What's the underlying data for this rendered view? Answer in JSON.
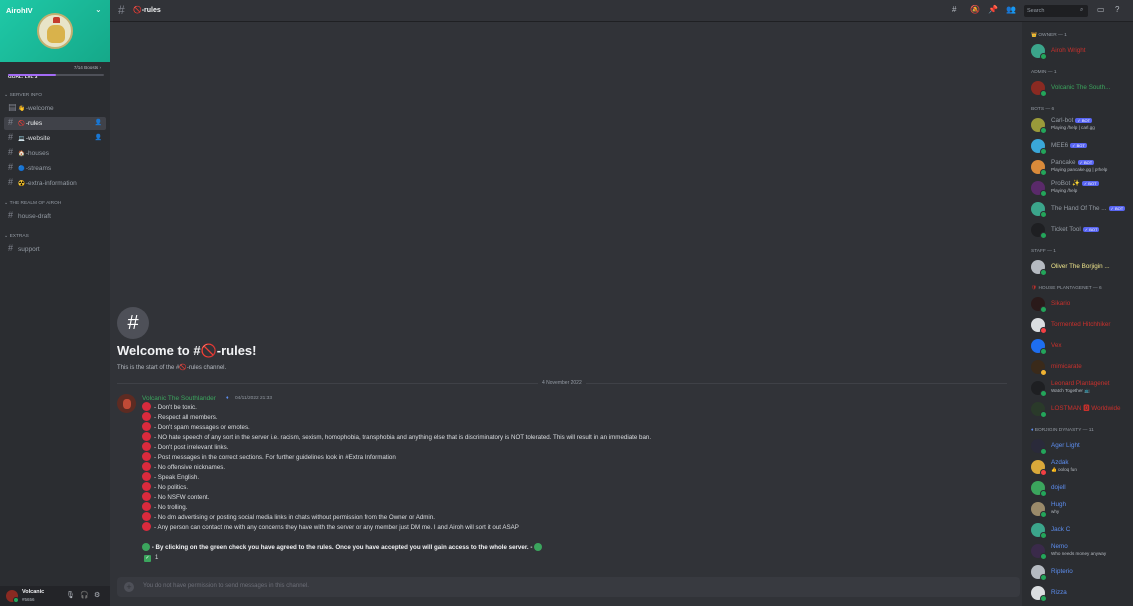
{
  "server": {
    "name": "AirohIV",
    "goal_label": "GOAL: LVL 3",
    "boosts": "7/14 Boosts",
    "boost_progress": 0.5
  },
  "sidebar": {
    "categories": [
      {
        "name": "SERVER INFO",
        "channels": [
          {
            "emoji": "👋",
            "name": "-welcome",
            "icon": "rules-icon"
          },
          {
            "emoji": "🚫",
            "name": "-rules",
            "icon": "hash-icon",
            "active": true
          },
          {
            "emoji": "💻",
            "name": "-website",
            "icon": "hash-icon"
          },
          {
            "emoji": "🏠",
            "name": "-houses",
            "icon": "hash-icon"
          },
          {
            "emoji": "🔵",
            "name": "-streams",
            "icon": "hash-icon"
          },
          {
            "emoji": "☢️",
            "name": "-extra-information",
            "icon": "hash-icon"
          }
        ]
      },
      {
        "name": "THE REALM OF AIROH",
        "channels": [
          {
            "name": "house-draft",
            "icon": "hash-icon"
          }
        ]
      },
      {
        "name": "EXTRAS",
        "channels": [
          {
            "name": "support",
            "icon": "hash-icon"
          }
        ]
      }
    ]
  },
  "user_panel": {
    "name": "Volcanic",
    "tag": "#5656"
  },
  "header": {
    "channel": "-rules",
    "search_placeholder": "Search"
  },
  "welcome": {
    "title": "Welcome to #🚫-rules!",
    "subtitle": "This is the start of the #🚫-rules channel."
  },
  "divider_date": "4 November 2022",
  "message": {
    "author": "Volcanic The Southlander",
    "timestamp": "04/11/2022 21:33",
    "rules": [
      "Don't be toxic.",
      "Respect all members.",
      "Don't spam messages or emotes.",
      "NO hate speech of any sort in the server i.e. racism, sexism, homophobia, transphobia and anything else that is discriminatory is NOT tolerated. This will result in an immediate ban.",
      "Don't post irrelevant links.",
      "Post messages in the correct sections. For further guidelines look in #Extra Information",
      "No offensive nicknames.",
      "Speak English.",
      "No politics.",
      "No NSFW content.",
      "No trolling.",
      "No dm advertising or posting social media links in chats without permission from the Owner or Admin.",
      "Any person can contact me with any concerns they have with the server or any member just DM me. I and Airoh will sort it out ASAP"
    ],
    "accept_text": "By clicking on the green check you have agreed to the rules. Once you have accepted you will gain access to the whole server.",
    "reaction_count": "1"
  },
  "input": {
    "placeholder": "You do not have permission to send messages in this channel."
  },
  "members": {
    "groups": [
      {
        "label": "OWNER — 1",
        "color": "#c9302c",
        "members": [
          {
            "name": "Airoh Wright",
            "avatar_color": "#3ba58b",
            "status": "online"
          }
        ]
      },
      {
        "label": "ADMIN — 1",
        "color": "#3ba55d",
        "members": [
          {
            "name": "Volcanic The South...",
            "avatar_color": "#8a2a22",
            "status": "online"
          }
        ]
      },
      {
        "label": "BOTS — 6",
        "color": "#949ba4",
        "members": [
          {
            "name": "Carl-bot",
            "activity": "Playing /help | carl.gg",
            "bot": true,
            "avatar_color": "#9a9a3a",
            "status": "online"
          },
          {
            "name": "MEE6",
            "bot": true,
            "avatar_color": "#3aa7d9",
            "status": "online"
          },
          {
            "name": "Pancake",
            "activity": "Playing pancake.gg | p!help",
            "bot": true,
            "avatar_color": "#d98a3a",
            "status": "online"
          },
          {
            "name": "ProBot ✨",
            "activity": "Playing /help",
            "bot": true,
            "avatar_color": "#5a2a6a",
            "status": "online"
          },
          {
            "name": "The Hand Of The ...",
            "bot": true,
            "avatar_color": "#3ba58b",
            "status": "online"
          },
          {
            "name": "Ticket Tool",
            "bot": true,
            "avatar_color": "#1e1f22",
            "status": "online"
          }
        ]
      },
      {
        "label": "STAFF — 1",
        "color": "#f0e68c",
        "members": [
          {
            "name": "Oliver The Borjigin ...",
            "avatar_color": "#b5bac1",
            "status": "online"
          }
        ]
      },
      {
        "label": "HOUSE PLANTAGENET — 6",
        "color": "#c9302c",
        "members": [
          {
            "name": "Sikario",
            "avatar_color": "#2a1a1a",
            "status": "online"
          },
          {
            "name": "Tormented Hitchhiker",
            "avatar_color": "#dbdee1",
            "status": "dnd"
          },
          {
            "name": "Vex",
            "avatar_color": "#1e6ef0",
            "status": "online"
          },
          {
            "name": "mimicarate",
            "avatar_color": "#3a2a1a",
            "status": "idle"
          },
          {
            "name": "Leonard Plantagenet",
            "activity": "Watch Together 📺",
            "avatar_color": "#1e1f22",
            "status": "online"
          },
          {
            "name": "LOSTMAN 🅾 Worldwide",
            "avatar_color": "#2a3a2a",
            "status": "online"
          }
        ]
      },
      {
        "label": "BORJIGIN DYNASTY — 11",
        "color": "#5d8ef0",
        "members": [
          {
            "name": "Ager Light",
            "avatar_color": "#2a2a3a",
            "status": "online"
          },
          {
            "name": "Azdak",
            "activity": "👍 ooloq fun",
            "avatar_color": "#d9a83a",
            "status": "dnd"
          },
          {
            "name": "dojell",
            "avatar_color": "#3ba55d",
            "status": "online"
          },
          {
            "name": "Hugh",
            "activity": "why",
            "avatar_color": "#9a8a6a",
            "status": "online"
          },
          {
            "name": "Jack C",
            "avatar_color": "#3ba58b",
            "status": "online"
          },
          {
            "name": "Nemo",
            "activity": "Who needs money anyway",
            "avatar_color": "#3a2a4a",
            "status": "online"
          },
          {
            "name": "Ripterio",
            "avatar_color": "#b5bac1",
            "status": "online"
          },
          {
            "name": "Rizza",
            "avatar_color": "#dbdee1",
            "status": "online"
          }
        ]
      }
    ]
  }
}
